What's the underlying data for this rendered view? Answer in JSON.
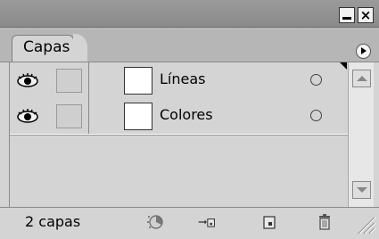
{
  "panel": {
    "tab_label": "Capas",
    "window_buttons": {
      "minimize": "minimize-icon",
      "close": "×"
    }
  },
  "layers": [
    {
      "name": "Líneas",
      "visible": true,
      "selected": false
    },
    {
      "name": "Colores",
      "visible": true,
      "selected": false
    }
  ],
  "footer": {
    "count_label": "2 capas",
    "buttons": [
      {
        "icon": "layer-effects-icon"
      },
      {
        "icon": "move-to-layer-icon"
      },
      {
        "icon": "new-layer-icon"
      },
      {
        "icon": "trash-icon"
      }
    ]
  },
  "colors": {
    "panel_bg": "#d4d4d4",
    "titlebar": "#8f8f8f",
    "tabstrip": "#b6b6b6"
  }
}
